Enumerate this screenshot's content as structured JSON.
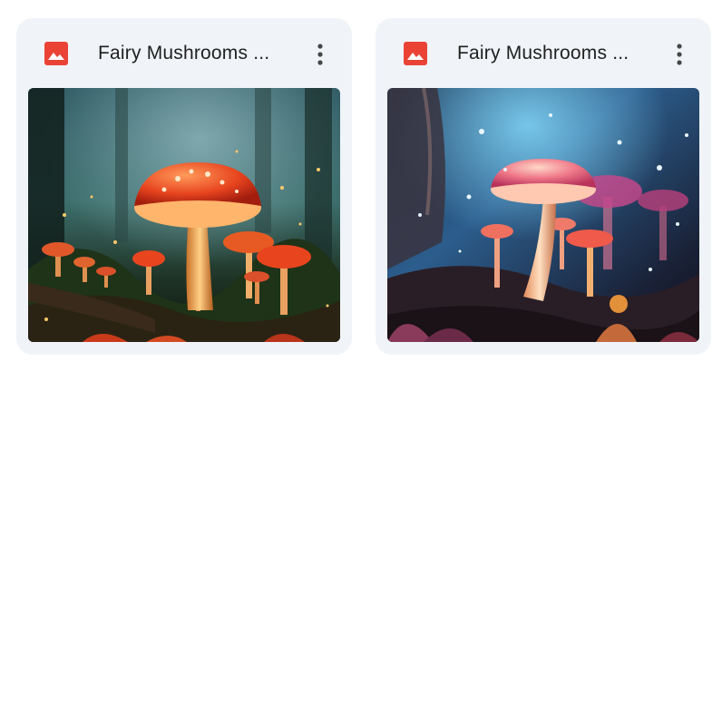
{
  "files": [
    {
      "title": "Fairy Mushrooms ...",
      "icon": "image-file-icon",
      "icon_color": "#ea4335",
      "thumbnail": "fairy-mushrooms-orange-forest"
    },
    {
      "title": "Fairy Mushrooms ...",
      "icon": "image-file-icon",
      "icon_color": "#ea4335",
      "thumbnail": "fairy-mushrooms-pink-forest"
    }
  ],
  "colors": {
    "card_background": "#f0f4f9",
    "title_text": "#1f1f1f",
    "menu_icon": "#444746"
  }
}
